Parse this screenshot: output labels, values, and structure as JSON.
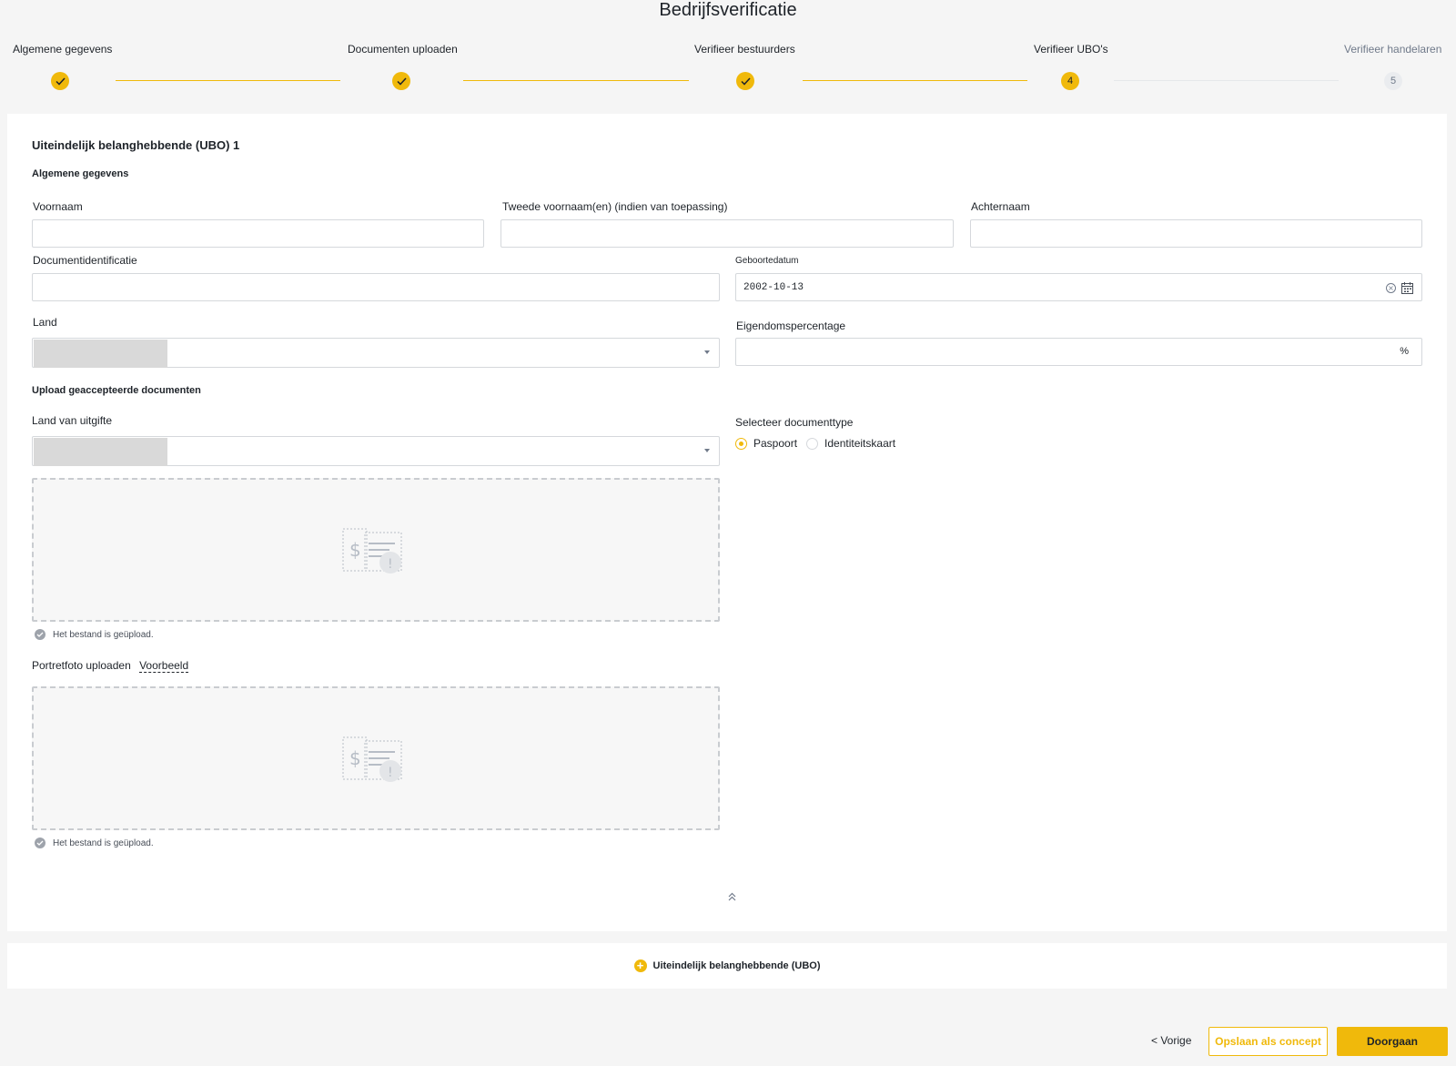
{
  "page": {
    "title": "Bedrijfsverificatie"
  },
  "stepper": {
    "steps": [
      {
        "label": "Algemene gegevens",
        "state": "done",
        "number": ""
      },
      {
        "label": "Documenten uploaden",
        "state": "done",
        "number": ""
      },
      {
        "label": "Verifieer bestuurders",
        "state": "done",
        "number": ""
      },
      {
        "label": "Verifieer UBO's",
        "state": "current",
        "number": "4"
      },
      {
        "label": "Verifieer handelaren",
        "state": "pending",
        "number": "5"
      }
    ]
  },
  "ubo": {
    "title": "Uiteindelijk belanghebbende (UBO) 1",
    "general_section": "Algemene gegevens",
    "fields": {
      "first_name": {
        "label": "Voornaam",
        "value": ""
      },
      "middle_name": {
        "label": "Tweede voornaam(en) (indien van toepassing)",
        "value": ""
      },
      "last_name": {
        "label": "Achternaam",
        "value": ""
      },
      "document_id": {
        "label": "Documentidentificatie",
        "value": ""
      },
      "birth_date": {
        "label": "Geboortedatum",
        "value": "2002-10-13"
      },
      "country": {
        "label": "Land",
        "value": ""
      },
      "ownership": {
        "label": "Eigendomspercentage",
        "value": "",
        "suffix": "%"
      }
    },
    "upload_section": "Upload geaccepteerde documenten",
    "issuing_country": {
      "label": "Land van uitgifte",
      "value": ""
    },
    "document_type": {
      "label": "Selecteer documenttype",
      "options": [
        "Paspoort",
        "Identiteitskaart"
      ],
      "selected": "Paspoort"
    },
    "upload_status": "Het bestand is geüpload.",
    "portrait": {
      "label": "Portretfoto uploaden",
      "example": "Voorbeeld"
    }
  },
  "add_ubo": {
    "label": "Uiteindelijk belanghebbende (UBO)"
  },
  "footer": {
    "prev": "< Vorige",
    "save_draft": "Opslaan als concept",
    "continue": "Doorgaan"
  },
  "colors": {
    "accent": "#f0b90b",
    "text": "#1e2329",
    "muted": "#707a8a"
  },
  "icons": [
    "check-icon",
    "clear-icon",
    "calendar-icon",
    "dropdown-arrow-icon",
    "document-upload-icon",
    "collapse-up-icon",
    "plus-icon"
  ]
}
